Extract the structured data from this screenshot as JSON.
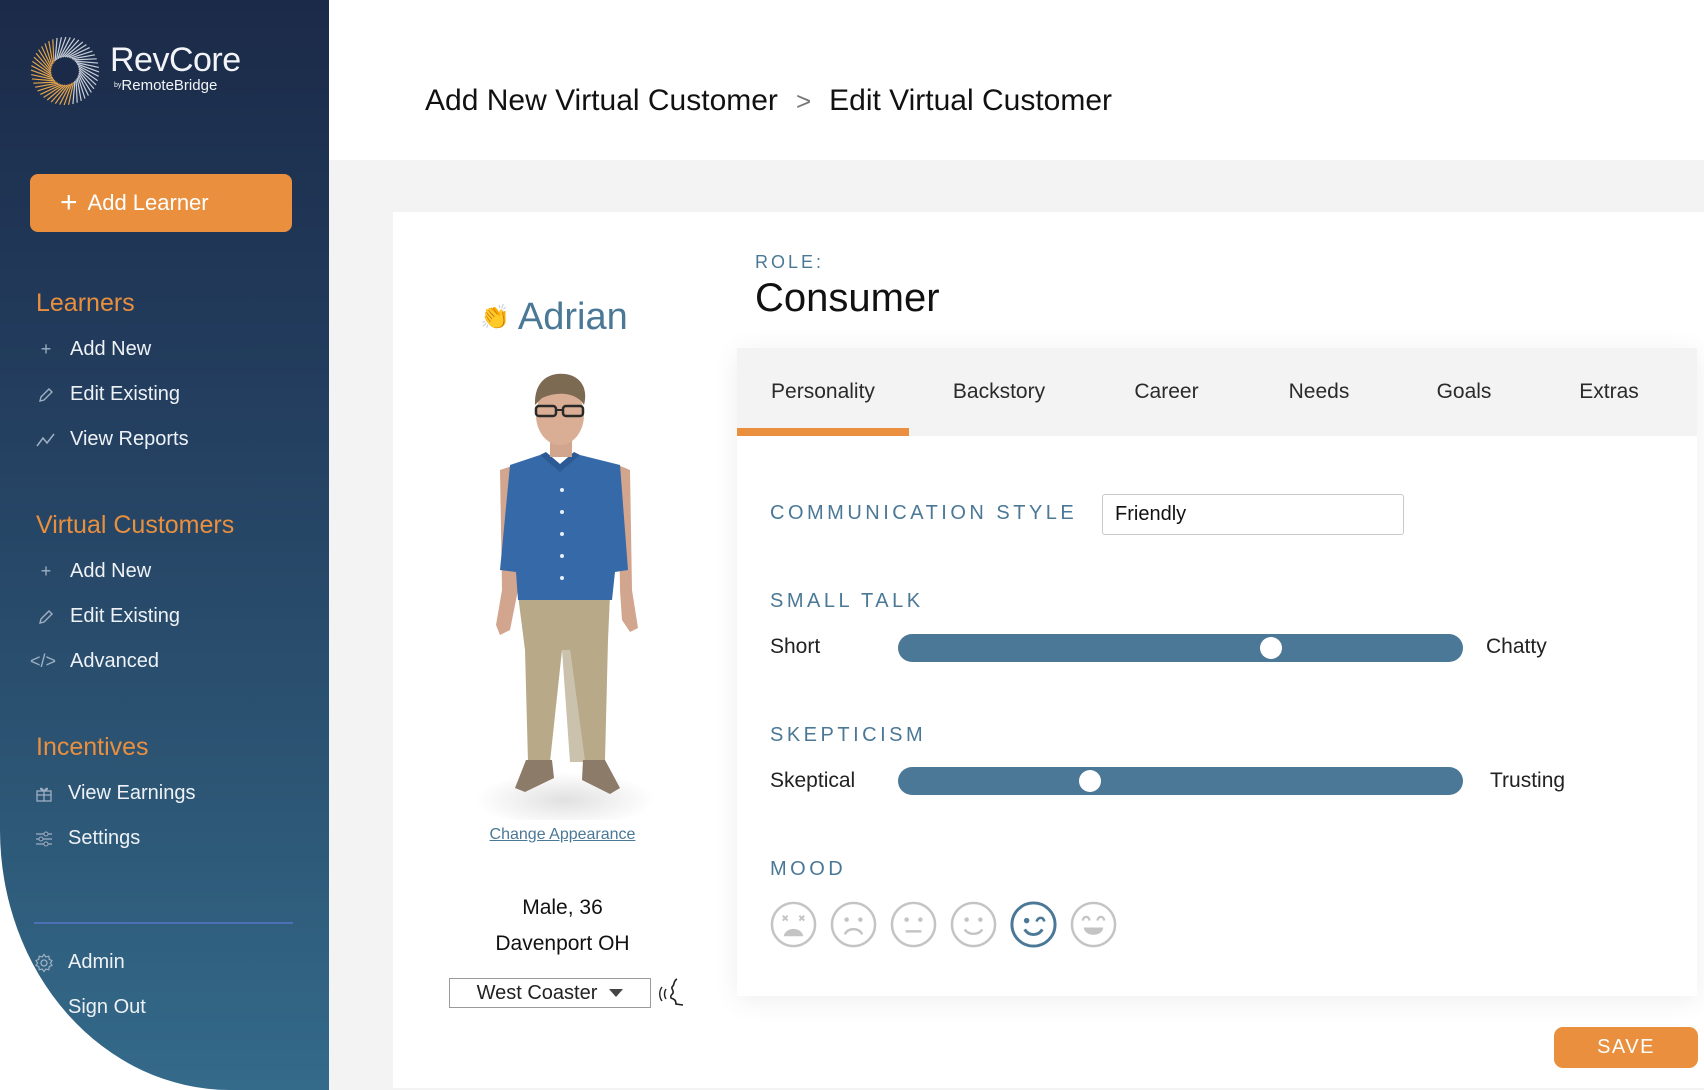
{
  "brand": {
    "name": "RevCore",
    "by_prefix": "by",
    "by_name": "RemoteBridge"
  },
  "sidebar": {
    "add_learner_label": "Add Learner",
    "sections": [
      {
        "heading": "Learners",
        "items": [
          {
            "label": "Add New",
            "icon": "plus-icon"
          },
          {
            "label": "Edit Existing",
            "icon": "pencil-icon"
          },
          {
            "label": "View Reports",
            "icon": "chart-line-icon"
          }
        ]
      },
      {
        "heading": "Virtual Customers",
        "items": [
          {
            "label": "Add New",
            "icon": "plus-icon"
          },
          {
            "label": "Edit Existing",
            "icon": "pencil-icon"
          },
          {
            "label": "Advanced",
            "icon": "code-icon"
          }
        ]
      },
      {
        "heading": "Incentives",
        "items": [
          {
            "label": "View Earnings",
            "icon": "gift-icon"
          },
          {
            "label": "Settings",
            "icon": "sliders-icon"
          }
        ]
      }
    ],
    "footer_items": [
      {
        "label": "Admin",
        "icon": "gear-icon"
      },
      {
        "label": "Sign Out",
        "icon": "sign-out-icon"
      }
    ]
  },
  "breadcrumb": {
    "parent": "Add New Virtual Customer",
    "separator": ">",
    "current": "Edit Virtual Customer"
  },
  "customer": {
    "wave_emoji": "👏",
    "name": "Adrian",
    "change_appearance_label": "Change Appearance",
    "gender_age": "Male, 36",
    "location": "Davenport OH",
    "accent_selected": "West Coaster"
  },
  "role": {
    "label": "ROLE:",
    "value": "Consumer"
  },
  "tabs": [
    {
      "label": "Personality",
      "active": true
    },
    {
      "label": "Backstory",
      "active": false
    },
    {
      "label": "Career",
      "active": false
    },
    {
      "label": "Needs",
      "active": false
    },
    {
      "label": "Goals",
      "active": false
    },
    {
      "label": "Extras",
      "active": false
    }
  ],
  "personality": {
    "communication_style": {
      "label": "COMMUNICATION STYLE",
      "value": "Friendly"
    },
    "small_talk": {
      "label": "SMALL TALK",
      "min_label": "Short",
      "max_label": "Chatty",
      "value": 0.66
    },
    "skepticism": {
      "label": "SKEPTICISM",
      "min_label": "Skeptical",
      "max_label": "Trusting",
      "value": 0.34
    },
    "mood": {
      "label": "MOOD",
      "options": [
        "distressed",
        "sad",
        "neutral",
        "content",
        "playful",
        "joyful"
      ],
      "selected_index": 4
    }
  },
  "colors": {
    "accent_orange": "#e98f3e",
    "steel_blue": "#4a7896",
    "sidebar_top": "#1b2a48",
    "sidebar_bottom": "#346a8a"
  },
  "save_label": "SAVE"
}
